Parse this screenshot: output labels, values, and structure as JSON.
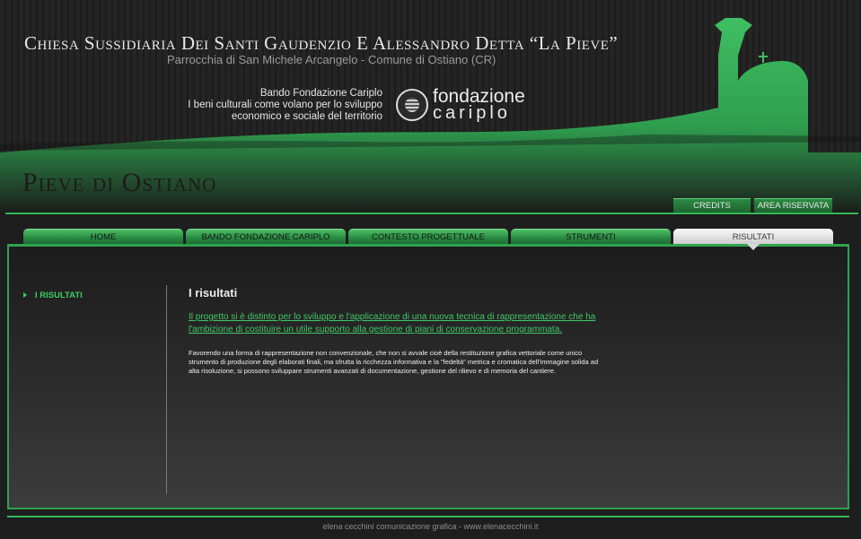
{
  "header": {
    "title": "Chiesa Sussidiaria Dei Santi Gaudenzio E Alessandro Detta “La Pieve”",
    "subtitle": "Parrocchia di San Michele Arcangelo - Comune di Ostiano (CR)",
    "bando_lines": [
      "Bando Fondazione Cariplo",
      "I beni culturali come volano per lo sviluppo",
      "economico e sociale del territorio"
    ],
    "logo_line1": "fondazione",
    "logo_line2": "cariplo",
    "site_name": "Pieve di Ostiano"
  },
  "util_nav": {
    "credits": "CREDITS",
    "area_riservata": "AREA RISERVATA"
  },
  "tabs": [
    {
      "label": "HOME"
    },
    {
      "label": "BANDO FONDAZIONE CARIPLO"
    },
    {
      "label": "CONTESTO PROGETTUALE"
    },
    {
      "label": "STRUMENTI"
    },
    {
      "label": "RISULTATI",
      "active": true
    }
  ],
  "sidebar": {
    "items": [
      {
        "label": "I RISULTATI"
      }
    ]
  },
  "main": {
    "title": "I risultati",
    "lead": "Il progetto si è distinto per lo sviluppo e l'applicazione di una nuova tecnica di rappresentazione che ha l'ambizione di costituire un utile supporto alla gestione di piani di conservazione programmata.",
    "body": "Favorendo una forma di rappresentazione non convenzionale, che non si avvale cioè della restituzione grafica vettoriale come unico strumento di produzione degli elaborati finali, ma sfrutta la ricchezza informativa e la \"fedeltà\" metrica e cromatica dell'immagine solida ad alta risoluzione, si possono sviluppare strumenti avanzati di documentazione, gestione del rilievo e di memoria del cantiere."
  },
  "footer": {
    "text": "elena cecchini comunicazione grafica - www.elenacecchini.it"
  },
  "colors": {
    "accent_green": "#34b855",
    "link_green": "#40c866",
    "background": "#1e1e1e"
  }
}
